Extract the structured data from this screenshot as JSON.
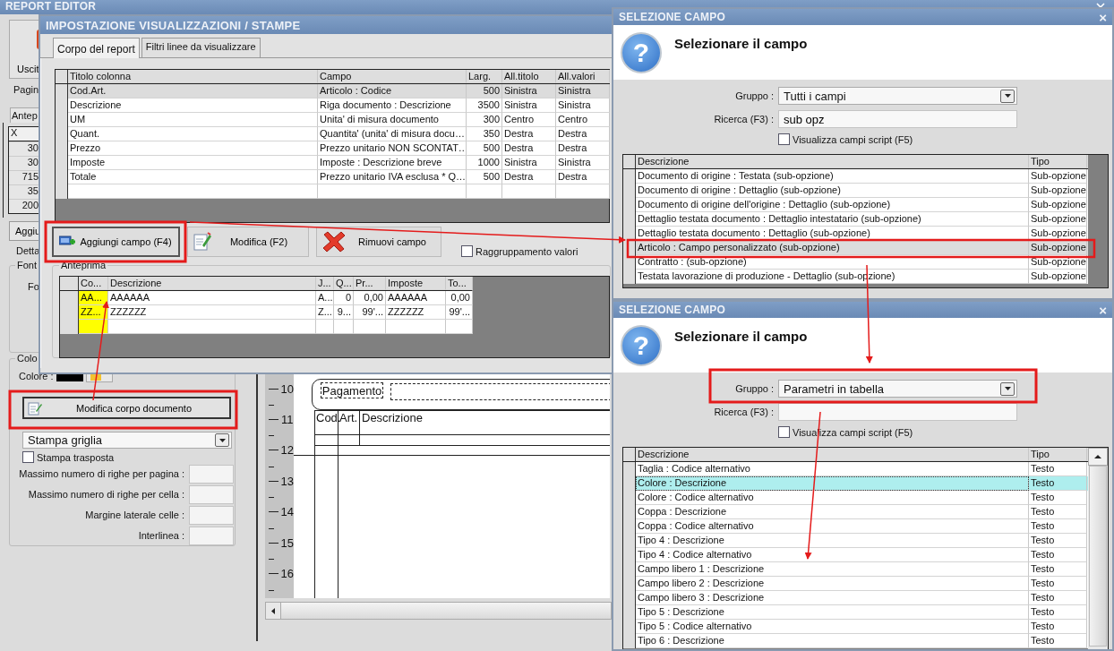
{
  "report_editor": {
    "title": "REPORT EDITOR",
    "exit_label": "Uscit",
    "page_label": "Pagin",
    "preview_tab": "Antep",
    "x_column": "X",
    "x_values": [
      "30",
      "30",
      "715",
      "35",
      "200"
    ],
    "add_label": "Aggiu",
    "detail_label": "Detta",
    "font_group": "Font",
    "font_label": "Fo",
    "color_group": "Colo",
    "color_label": "Colore :",
    "edit_body_button": "Modifica corpo documento",
    "grid_print": "Stampa griglia",
    "transpose": {
      "label": "Stampa trasposta",
      "checked": false
    },
    "fields": [
      "Massimo numero di righe per pagina :",
      "Massimo numero di righe per cella :",
      "Margine laterale celle :",
      "Interlinea :"
    ],
    "ruler": [
      "10",
      "11",
      "12",
      "13",
      "14",
      "15",
      "16"
    ],
    "page": {
      "payment_label": "Pagamento",
      "columns": [
        "Cod.",
        "Art.",
        "Descrizione"
      ]
    }
  },
  "settings_dialog": {
    "title": "IMPOSTAZIONE VISUALIZZAZIONI / STAMPE",
    "tabs": [
      {
        "label": "Corpo del report",
        "selected": true
      },
      {
        "label": "Filtri linee da visualizzare",
        "selected": false
      }
    ],
    "columns": [
      "Titolo colonna",
      "Campo",
      "Larg.",
      "All.titolo",
      "All.valori"
    ],
    "rows": [
      {
        "cells": [
          "Cod.Art.",
          "Articolo : Codice",
          "500",
          "Sinistra",
          "Sinistra"
        ],
        "selected": true
      },
      {
        "cells": [
          "Descrizione",
          "Riga documento : Descrizione",
          "3500",
          "Sinistra",
          "Sinistra"
        ],
        "selected": false
      },
      {
        "cells": [
          "UM",
          "Unita' di misura documento",
          "300",
          "Centro",
          "Centro"
        ],
        "selected": false
      },
      {
        "cells": [
          "Quant.",
          "Quantita' (unita' di misura docu…",
          "350",
          "Destra",
          "Destra"
        ],
        "selected": false
      },
      {
        "cells": [
          "Prezzo",
          "Prezzo unitario NON SCONTAT…",
          "500",
          "Destra",
          "Destra"
        ],
        "selected": false
      },
      {
        "cells": [
          "Imposte",
          "Imposte : Descrizione breve",
          "1000",
          "Sinistra",
          "Sinistra"
        ],
        "selected": false
      },
      {
        "cells": [
          "Totale",
          "Prezzo unitario IVA esclusa * Q…",
          "500",
          "Destra",
          "Destra"
        ],
        "selected": false
      }
    ],
    "buttons": [
      {
        "label": "Aggiungi campo (F4)",
        "kind": "add"
      },
      {
        "label": "Modifica (F2)",
        "kind": "edit"
      },
      {
        "label": "Rimuovi campo",
        "kind": "remove"
      }
    ],
    "group_values": {
      "label": "Raggruppamento valori",
      "checked": false
    },
    "preview": {
      "title": "Anteprima",
      "columns": [
        "Co...",
        "Descrizione",
        "J...",
        "Q...",
        "Pr...",
        "Imposte",
        "To..."
      ],
      "rows": [
        [
          "AA...",
          "AAAAAA",
          "A...",
          "0",
          "0,00",
          "AAAAAA",
          "0,00"
        ],
        [
          "ZZ...",
          "ZZZZZZ",
          "Z...",
          "9...",
          "99'...",
          "ZZZZZZ",
          "99'..."
        ]
      ]
    }
  },
  "field_pickers": [
    {
      "title": "SELEZIONE CAMPO",
      "close": "×",
      "icon": "?",
      "heading": "Selezionare il campo",
      "group_label": "Gruppo :",
      "group": "Tutti i campi",
      "search_label": "Ricerca (F3) :",
      "search": "sub opz",
      "script_fields": {
        "label": "Visualizza campi script (F5)",
        "checked": false
      },
      "columns": [
        "Descrizione",
        "Tipo"
      ],
      "rows": [
        {
          "cells": [
            "Documento di origine : Testata (sub-opzione)",
            "Sub-opzione"
          ],
          "selected": false
        },
        {
          "cells": [
            "Documento di origine : Dettaglio (sub-opzione)",
            "Sub-opzione"
          ],
          "selected": false
        },
        {
          "cells": [
            "Documento di origine dell'origine : Dettaglio (sub-opzione)",
            "Sub-opzione"
          ],
          "selected": false
        },
        {
          "cells": [
            "Dettaglio testata documento : Dettaglio intestatario (sub-opzione)",
            "Sub-opzione"
          ],
          "selected": false
        },
        {
          "cells": [
            "Dettaglio testata documento : Dettaglio (sub-opzione)",
            "Sub-opzione"
          ],
          "selected": false
        },
        {
          "cells": [
            "Articolo : Campo personalizzato (sub-opzione)",
            "Sub-opzione"
          ],
          "selected": true
        },
        {
          "cells": [
            "Contratto : (sub-opzione)",
            "Sub-opzione"
          ],
          "selected": false
        },
        {
          "cells": [
            "Testata lavorazione di produzione - Dettaglio (sub-opzione)",
            "Sub-opzione"
          ],
          "selected": false
        }
      ]
    },
    {
      "title": "SELEZIONE CAMPO",
      "close": "×",
      "icon": "?",
      "heading": "Selezionare il campo",
      "group_label": "Gruppo :",
      "group": "Parametri in tabella",
      "search_label": "Ricerca (F3) :",
      "script_fields": {
        "label": "Visualizza campi script (F5)",
        "checked": false
      },
      "columns": [
        "Descrizione",
        "Tipo"
      ],
      "rows": [
        {
          "cells": [
            "Taglia : Codice alternativo",
            "Testo"
          ],
          "selected": false
        },
        {
          "cells": [
            "Colore : Descrizione",
            "Testo"
          ],
          "selected": true
        },
        {
          "cells": [
            "Colore : Codice alternativo",
            "Testo"
          ],
          "selected": false
        },
        {
          "cells": [
            "Coppa : Descrizione",
            "Testo"
          ],
          "selected": false
        },
        {
          "cells": [
            "Coppa : Codice alternativo",
            "Testo"
          ],
          "selected": false
        },
        {
          "cells": [
            "Tipo 4 : Descrizione",
            "Testo"
          ],
          "selected": false
        },
        {
          "cells": [
            "Tipo 4 : Codice alternativo",
            "Testo"
          ],
          "selected": false
        },
        {
          "cells": [
            "Campo libero 1 : Descrizione",
            "Testo"
          ],
          "selected": false
        },
        {
          "cells": [
            "Campo libero 2 : Descrizione",
            "Testo"
          ],
          "selected": false
        },
        {
          "cells": [
            "Campo libero 3 : Descrizione",
            "Testo"
          ],
          "selected": false
        },
        {
          "cells": [
            "Tipo 5 : Descrizione",
            "Testo"
          ],
          "selected": false
        },
        {
          "cells": [
            "Tipo 5 : Codice alternativo",
            "Testo"
          ],
          "selected": false
        },
        {
          "cells": [
            "Tipo 6 : Descrizione",
            "Testo"
          ],
          "selected": false
        }
      ]
    }
  ]
}
